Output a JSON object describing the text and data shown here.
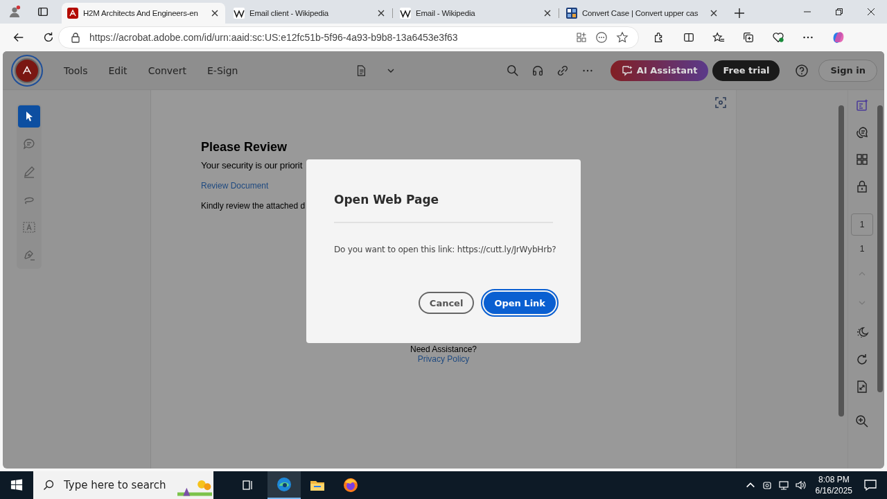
{
  "browser": {
    "tabs": [
      {
        "title": "H2M Architects And Engineers-en",
        "kind": "acrobat",
        "selected": true
      },
      {
        "title": "Email client - Wikipedia",
        "kind": "wikipedia",
        "selected": false
      },
      {
        "title": "Email - Wikipedia",
        "kind": "wikipedia",
        "selected": false
      },
      {
        "title": "Convert Case | Convert upper cas",
        "kind": "grid",
        "selected": false
      }
    ],
    "url": "https://acrobat.adobe.com/id/urn:aaid:sc:US:e12fc51b-5f96-4a93-b9b8-13a6453e3f63"
  },
  "acrobat": {
    "menu": [
      "Tools",
      "Edit",
      "Convert",
      "E-Sign"
    ],
    "ai_button": "AI Assistant",
    "trial_button": "Free trial",
    "signin_button": "Sign in",
    "left_tools": [
      {
        "kind": "select",
        "selected": true
      },
      {
        "kind": "comment",
        "selected": false
      },
      {
        "kind": "draw",
        "selected": false
      },
      {
        "kind": "lasso",
        "selected": false
      },
      {
        "kind": "text",
        "selected": false
      },
      {
        "kind": "sign",
        "selected": false
      }
    ],
    "page_field": "1",
    "page_count": "1"
  },
  "document": {
    "heading": "Please Review",
    "line_1": "Your security is our priorit",
    "link": "Review Document",
    "line_2": "Kindly review the attached d",
    "assistance": "Need Assistance?",
    "privacy_link": "Privacy Policy"
  },
  "dialog": {
    "title": "Open Web Page",
    "message": "Do you want to open this link: https://cutt.ly/JrWybHrb?",
    "cancel": "Cancel",
    "confirm": "Open Link"
  },
  "taskbar": {
    "search_placeholder": "Type here to search",
    "time": "8:08 PM",
    "date": "6/16/2025"
  }
}
